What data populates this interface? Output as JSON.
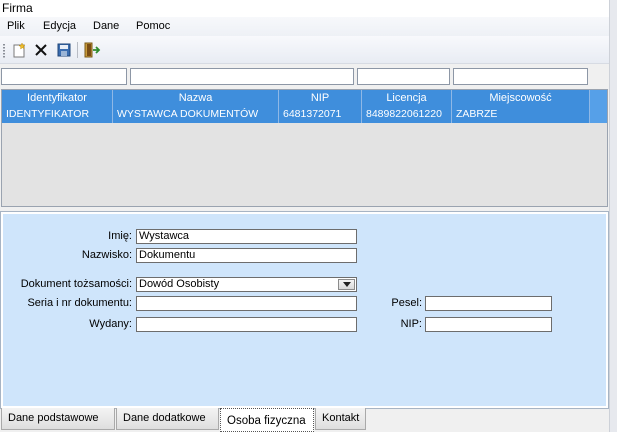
{
  "window": {
    "title": "Firma"
  },
  "menu": {
    "items": [
      "Plik",
      "Edycja",
      "Dane",
      "Pomoc"
    ]
  },
  "toolbar": {
    "icons": [
      "new-document-icon",
      "delete-x-icon",
      "save-disk-icon",
      "exit-door-icon"
    ]
  },
  "grid": {
    "columns": [
      "Identyfikator",
      "Nazwa",
      "NIP",
      "Licencja",
      "Miejscowość"
    ],
    "rows": [
      [
        "IDENTYFIKATOR",
        "WYSTAWCA DOKUMENTÓW",
        "6481372071",
        "8489822061220",
        "ZABRZE"
      ]
    ]
  },
  "form": {
    "imie_label": "Imię:",
    "imie_value": "Wystawca",
    "nazwisko_label": "Nazwisko:",
    "nazwisko_value": "Dokumentu",
    "dokument_label": "Dokument tożsamości:",
    "dokument_value": "Dowód Osobisty",
    "seria_label": "Seria i nr dokumentu:",
    "seria_value": "",
    "wydany_label": "Wydany:",
    "wydany_value": "",
    "pesel_label": "Pesel:",
    "pesel_value": "",
    "nip_label": "NIP:",
    "nip_value": ""
  },
  "tabs": [
    "Dane podstawowe",
    "Dane dodatkowe",
    "Osoba fizyczna",
    "Kontakt"
  ],
  "active_tab": "Osoba fizyczna",
  "colors": {
    "selection": "#3f8edc",
    "panel": "#cfe5fb"
  }
}
